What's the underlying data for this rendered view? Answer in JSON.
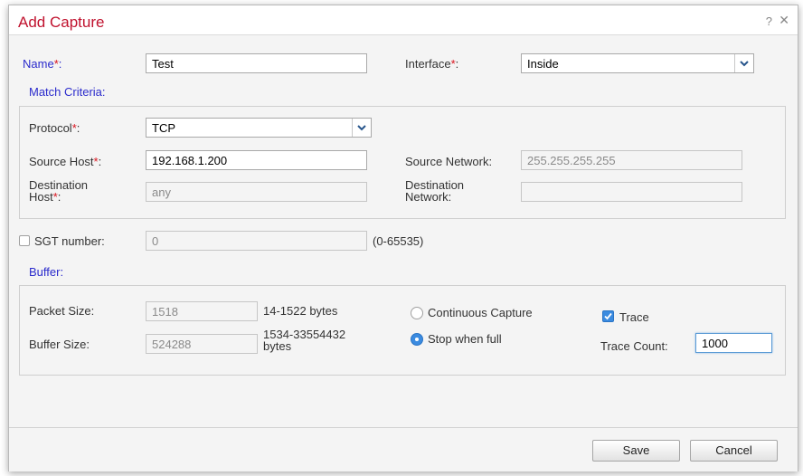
{
  "dialog": {
    "title": "Add Capture",
    "help_symbol": "?",
    "close_symbol": "✕"
  },
  "name": {
    "label": "Name",
    "required_mark": "*",
    "label_suffix": ":",
    "value": "Test"
  },
  "interface": {
    "label": "Interface",
    "required_mark": "*",
    "label_suffix": ":",
    "value": "Inside"
  },
  "match_criteria": {
    "heading": "Match Criteria:",
    "protocol": {
      "label": "Protocol",
      "required_mark": "*",
      "label_suffix": ":",
      "value": "TCP"
    },
    "source_host": {
      "label": "Source Host",
      "required_mark": "*",
      "label_suffix": ":",
      "value": "192.168.1.200"
    },
    "source_network": {
      "label": "Source Network:",
      "value": "255.255.255.255"
    },
    "destination_host": {
      "label_line1": "Destination",
      "label_line2": "Host",
      "required_mark": "*",
      "label_suffix": ":",
      "value": "any"
    },
    "destination_network": {
      "label_line1": "Destination",
      "label_line2": "Network:",
      "value": ""
    }
  },
  "sgt": {
    "label": "SGT number:",
    "value": "0",
    "range_hint": "(0-65535)",
    "checked": false
  },
  "buffer": {
    "heading": "Buffer:",
    "packet_size": {
      "label": "Packet Size:",
      "value": "1518",
      "hint": "14-1522 bytes"
    },
    "buffer_size": {
      "label": "Buffer Size:",
      "value": "524288",
      "hint_line1": "1534-33554432",
      "hint_line2": "bytes"
    },
    "continuous_capture": {
      "label": "Continuous Capture",
      "selected": false
    },
    "stop_when_full": {
      "label": "Stop when full",
      "selected": true
    },
    "trace": {
      "label": "Trace",
      "checked": true
    },
    "trace_count": {
      "label": "Trace Count:",
      "value": "1000"
    }
  },
  "footer": {
    "save_label": "Save",
    "cancel_label": "Cancel"
  },
  "colors": {
    "title_red": "#c0122e",
    "section_blue": "#2b2bcc",
    "required_red": "#d9141e",
    "accent_blue": "#3b8be0"
  },
  "icons": {
    "help": "help-icon",
    "close": "close-icon",
    "dropdown": "chevron-down-icon",
    "check": "checkmark-icon"
  }
}
